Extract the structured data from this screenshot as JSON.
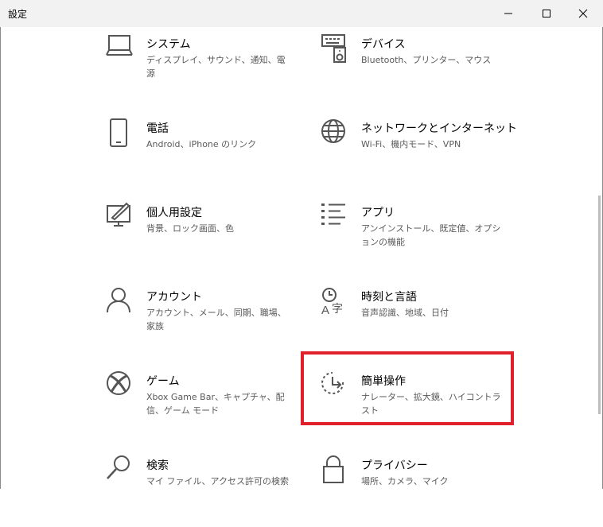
{
  "window": {
    "title": "設定"
  },
  "tiles": [
    {
      "name": "システム",
      "desc": "ディスプレイ、サウンド、通知、電源",
      "icon": "laptop-icon"
    },
    {
      "name": "デバイス",
      "desc": "Bluetooth、プリンター、マウス",
      "icon": "keyboard-speaker-icon"
    },
    {
      "name": "電話",
      "desc": "Android、iPhone のリンク",
      "icon": "phone-icon"
    },
    {
      "name": "ネットワークとインターネット",
      "desc": "Wi-Fi、機内モード、VPN",
      "icon": "globe-icon"
    },
    {
      "name": "個人用設定",
      "desc": "背景、ロック画面、色",
      "icon": "monitor-brush-icon"
    },
    {
      "name": "アプリ",
      "desc": "アンインストール、既定値、オプションの機能",
      "icon": "apps-list-icon"
    },
    {
      "name": "アカウント",
      "desc": "アカウント、メール、同期、職場、家族",
      "icon": "person-icon"
    },
    {
      "name": "時刻と言語",
      "desc": "音声認識、地域、日付",
      "icon": "time-language-icon"
    },
    {
      "name": "ゲーム",
      "desc": "Xbox Game Bar、キャプチャ、配信、ゲーム モード",
      "icon": "xbox-icon"
    },
    {
      "name": "簡単操作",
      "desc": "ナレーター、拡大鏡、ハイコントラスト",
      "icon": "ease-of-access-icon"
    },
    {
      "name": "検索",
      "desc": "マイ ファイル、アクセス許可の検索",
      "icon": "search-icon"
    },
    {
      "name": "プライバシー",
      "desc": "場所、カメラ、マイク",
      "icon": "lock-icon"
    }
  ],
  "colors": {
    "highlight": "#e0202a",
    "titlebar": "#f2f2f2",
    "desc_text": "#5a5a5a"
  }
}
